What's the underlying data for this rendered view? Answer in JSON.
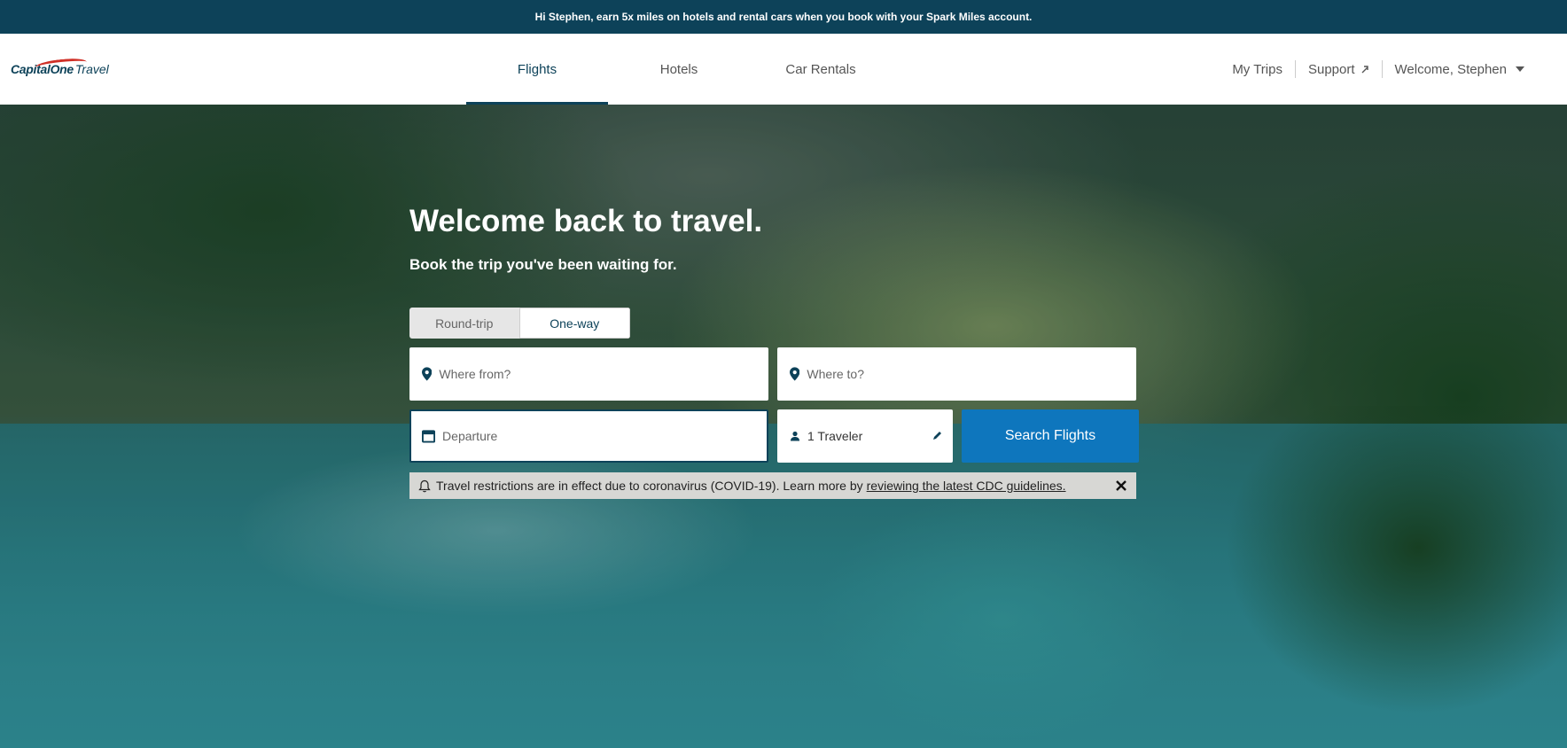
{
  "promo": {
    "text": "Hi Stephen, earn 5x miles on hotels and rental cars when you book with your Spark Miles account."
  },
  "logo": {
    "brand": "CapitalOne",
    "sub": "Travel"
  },
  "nav": {
    "tabs": [
      {
        "label": "Flights",
        "active": true
      },
      {
        "label": "Hotels",
        "active": false
      },
      {
        "label": "Car Rentals",
        "active": false
      }
    ]
  },
  "header": {
    "my_trips": "My Trips",
    "support": "Support",
    "welcome": "Welcome, Stephen"
  },
  "hero": {
    "headline_strong": "Welcome back",
    "headline_rest": " to travel.",
    "subhead": "Book the trip you've been waiting for."
  },
  "trip_type": {
    "round_trip": "Round-trip",
    "one_way": "One-way",
    "selected": "One-way"
  },
  "search": {
    "from_placeholder": "Where from?",
    "to_placeholder": "Where to?",
    "departure_placeholder": "Departure",
    "travelers": "1 Traveler",
    "button_label": "Search Flights"
  },
  "alert": {
    "text": "Travel restrictions are in effect due to coronavirus (COVID-19). Learn more by",
    "link": "reviewing the latest CDC guidelines."
  },
  "colors": {
    "brand_navy": "#0d4259",
    "button_blue": "#0e76bd",
    "logo_red": "#d03027"
  },
  "icons": [
    "location-pin-icon",
    "calendar-icon",
    "person-icon",
    "pencil-icon",
    "bell-icon",
    "close-icon",
    "external-link-icon",
    "chevron-down-icon"
  ]
}
